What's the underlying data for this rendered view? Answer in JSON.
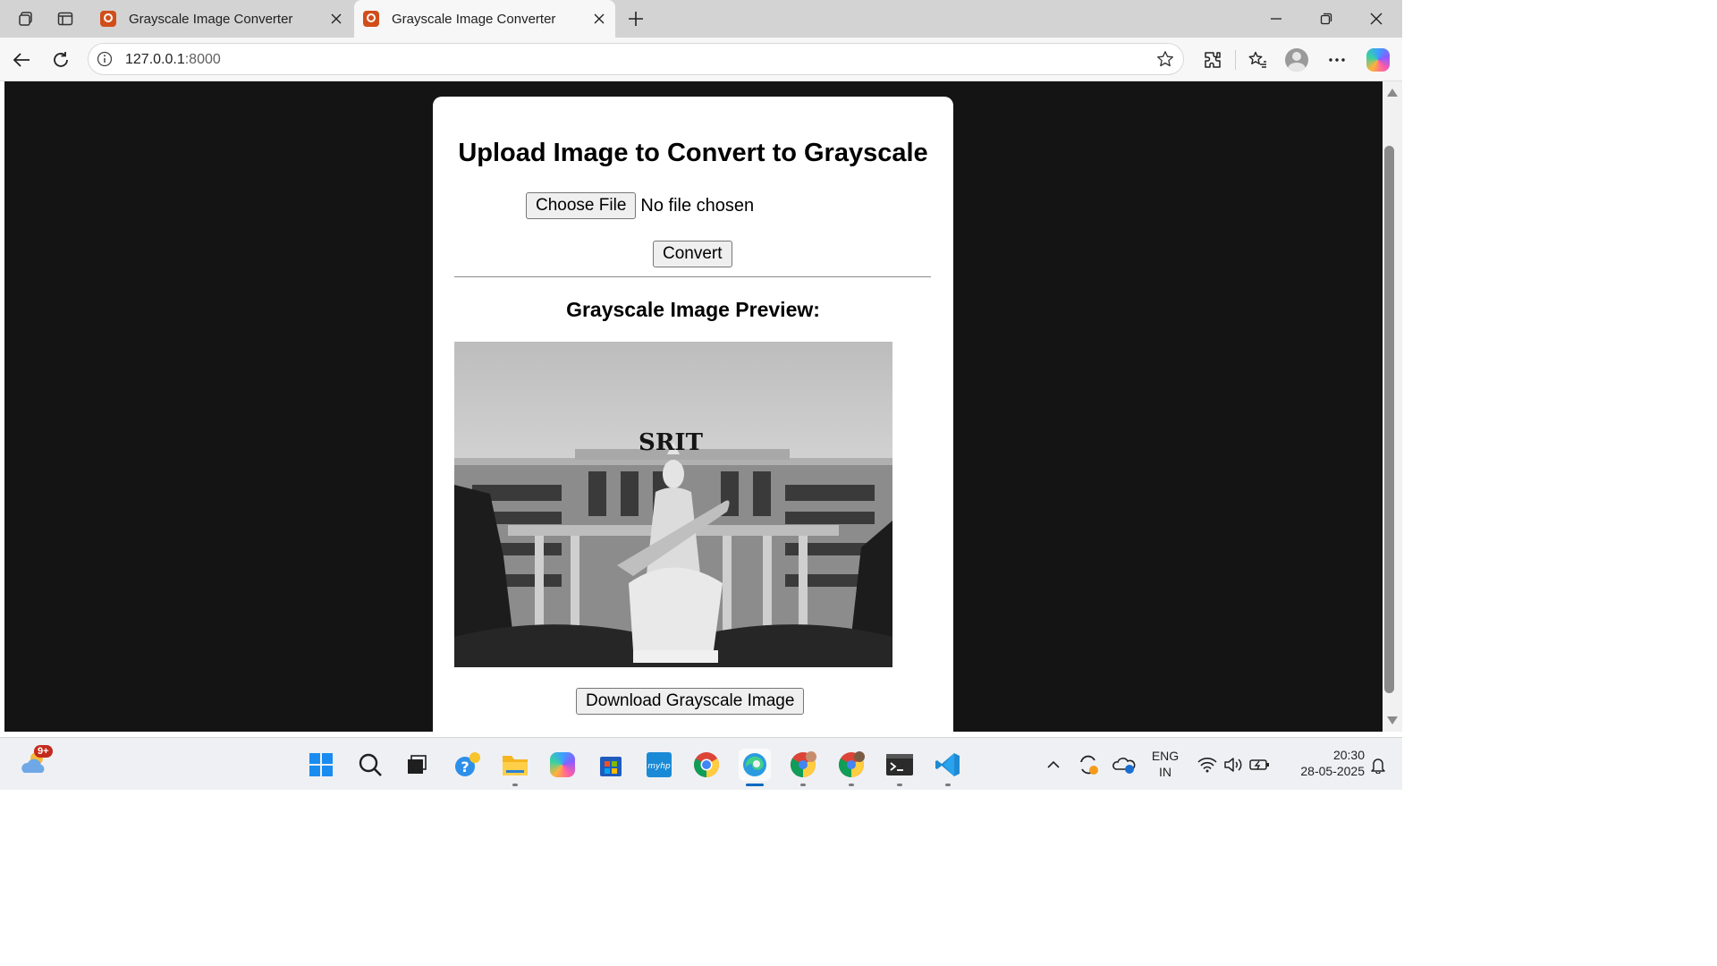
{
  "browser": {
    "tabs": [
      {
        "title": "Grayscale Image Converter",
        "active": false
      },
      {
        "title": "Grayscale Image Converter",
        "active": true
      }
    ],
    "address": {
      "host": "127.0.0.1",
      "port": ":8000"
    }
  },
  "page": {
    "heading": "Upload Image to Convert to Grayscale",
    "choose_file_label": "Choose File",
    "no_file_text": "No file chosen",
    "convert_label": "Convert",
    "preview_heading": "Grayscale Image Preview:",
    "preview_image_sign": "SRIT",
    "download_label": "Download Grayscale Image"
  },
  "taskbar": {
    "weather_badge": "9+",
    "apps": [
      "start-icon",
      "search-icon",
      "task-view-icon",
      "tips-icon",
      "file-explorer-icon",
      "copilot-icon",
      "store-icon",
      "myhp-icon",
      "chrome-icon",
      "edge-icon",
      "chrome-profile-icon",
      "chrome-profile-2-icon",
      "terminal-icon",
      "vscode-icon"
    ],
    "language_line1": "ENG",
    "language_line2": "IN",
    "time": "20:30",
    "date": "28-05-2025"
  }
}
